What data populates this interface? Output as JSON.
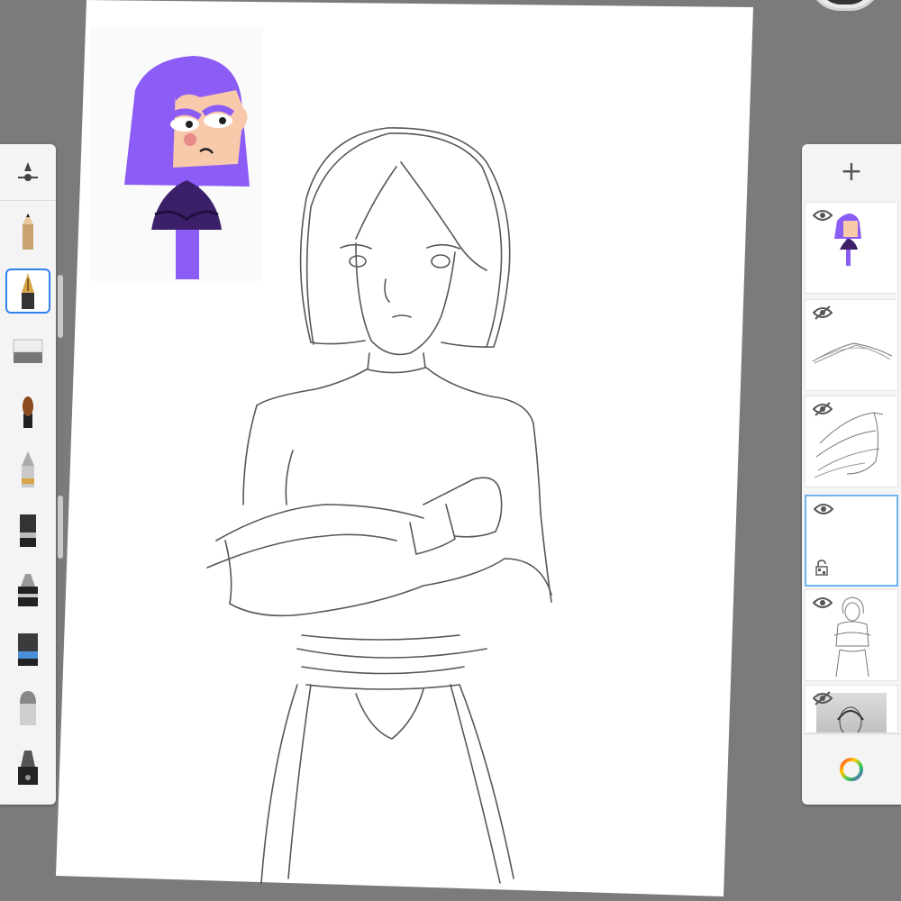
{
  "canvas": {
    "background": "#7b7b7b",
    "paper_color": "#ffffff",
    "sticker_colors": {
      "hair": "#8b5cf6",
      "skin": "#f8c9aa",
      "sweater": "#3b2069",
      "pole": "#8b5cf6"
    }
  },
  "toolbar": {
    "header_icon": "brush-size-icon",
    "tools": [
      {
        "name": "pencil-tool",
        "icon": "pencil-icon",
        "selected": false
      },
      {
        "name": "ink-pen-tool",
        "icon": "fountain-pen-icon",
        "selected": true
      },
      {
        "name": "eraser-tool",
        "icon": "eraser-icon",
        "selected": false
      },
      {
        "name": "paintbrush-tool",
        "icon": "paintbrush-icon",
        "selected": false
      },
      {
        "name": "ballpoint-tool",
        "icon": "ballpoint-icon",
        "selected": false
      },
      {
        "name": "flat-brush-tool",
        "icon": "flat-brush-icon",
        "selected": false
      },
      {
        "name": "marker-tool",
        "icon": "marker-icon",
        "selected": false
      },
      {
        "name": "wide-brush-tool",
        "icon": "wide-brush-icon",
        "selected": false
      },
      {
        "name": "chisel-tool",
        "icon": "chisel-icon",
        "selected": false
      },
      {
        "name": "calligraphy-tool",
        "icon": "calligraphy-icon",
        "selected": false
      }
    ]
  },
  "layers_panel": {
    "add_label": "+",
    "layers": [
      {
        "name": "layer-character-sticker",
        "visible": true,
        "active": false,
        "thumbnail": "character-sticker"
      },
      {
        "name": "layer-sketch-strokes-1",
        "visible": false,
        "active": false,
        "thumbnail": "strokes"
      },
      {
        "name": "layer-hand-study",
        "visible": false,
        "active": false,
        "thumbnail": "hand"
      },
      {
        "name": "layer-empty-active",
        "visible": true,
        "active": true,
        "thumbnail": "empty",
        "locked_indicator": true
      },
      {
        "name": "layer-figure-sketch",
        "visible": true,
        "active": false,
        "thumbnail": "figure"
      },
      {
        "name": "layer-reference-photo",
        "visible": false,
        "active": false,
        "thumbnail": "photo"
      }
    ],
    "color_picker_icon": "color-wheel-icon"
  }
}
